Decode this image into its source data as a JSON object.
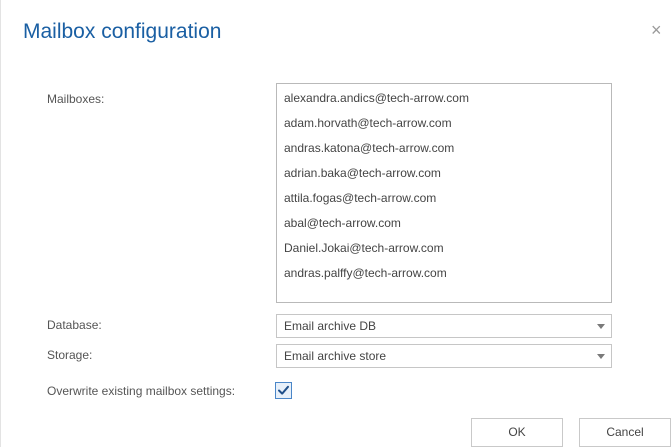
{
  "dialog": {
    "title": "Mailbox configuration",
    "close_glyph": "×"
  },
  "mailboxes": {
    "label": "Mailboxes:",
    "items": [
      "alexandra.andics@tech-arrow.com",
      "adam.horvath@tech-arrow.com",
      "andras.katona@tech-arrow.com",
      "adrian.baka@tech-arrow.com",
      "attila.fogas@tech-arrow.com",
      "abal@tech-arrow.com",
      "Daniel.Jokai@tech-arrow.com",
      "andras.palffy@tech-arrow.com"
    ]
  },
  "database": {
    "label": "Database:",
    "selected": "Email archive DB"
  },
  "storage": {
    "label": "Storage:",
    "selected": "Email archive store"
  },
  "overwrite": {
    "label": "Overwrite existing mailbox settings:",
    "checked": true
  },
  "buttons": {
    "ok": "OK",
    "cancel": "Cancel"
  },
  "colors": {
    "title": "#1a5fa3",
    "checkbox_border": "#4a86c8"
  }
}
